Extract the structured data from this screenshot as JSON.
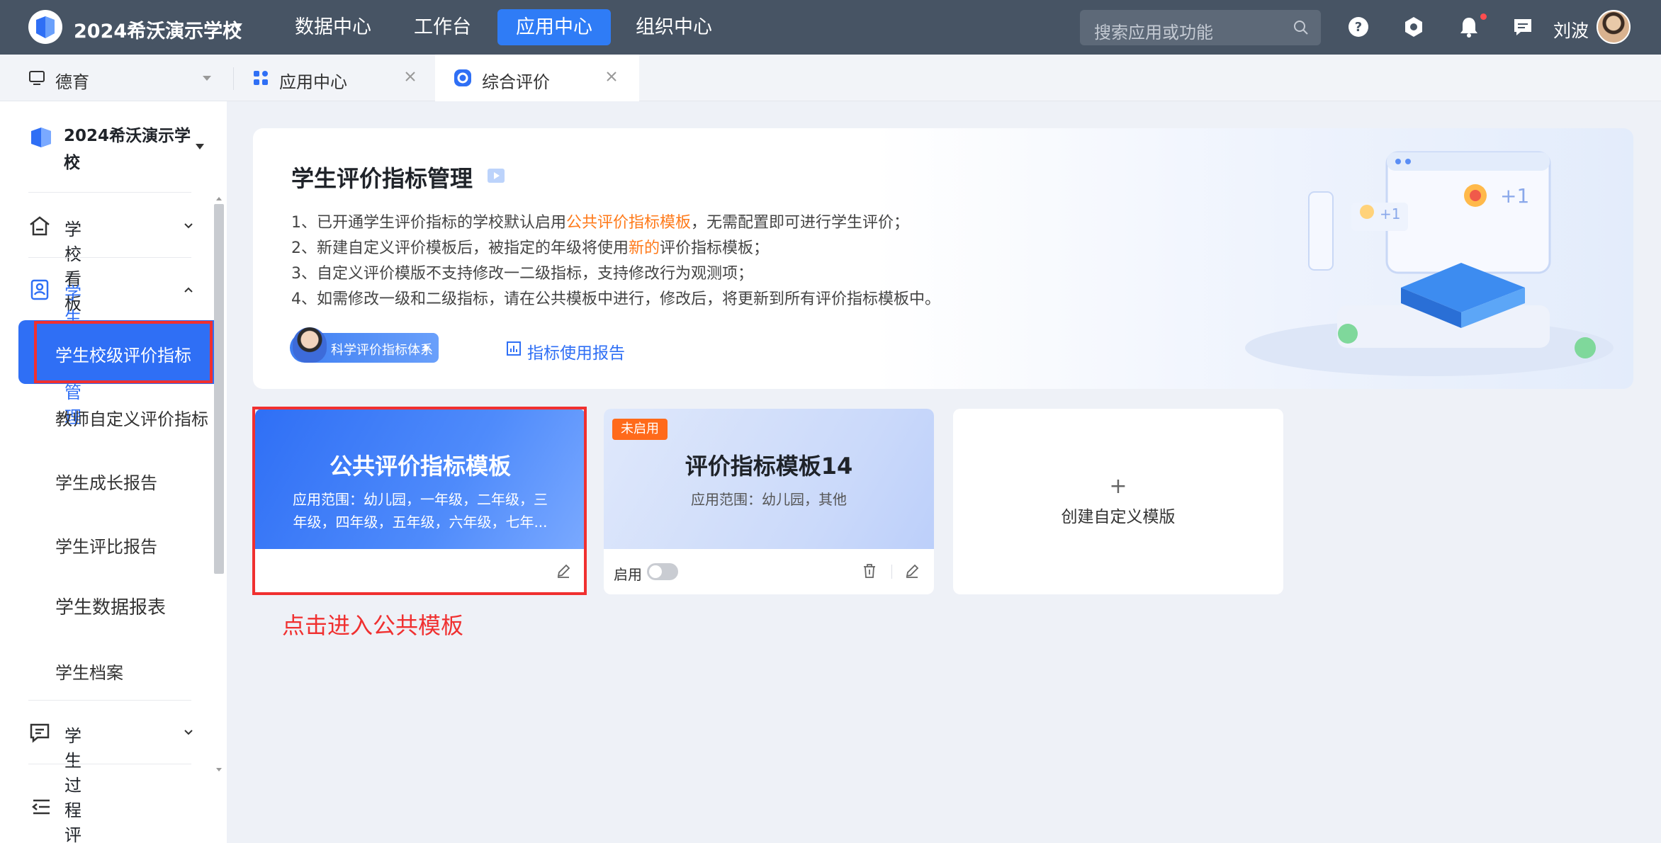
{
  "topbar": {
    "school_name": "2024希沃演示学校",
    "nav": [
      "数据中心",
      "工作台",
      "应用中心",
      "组织中心"
    ],
    "active_nav": "应用中心",
    "search_placeholder": "搜索应用或功能",
    "username": "刘波",
    "icons": [
      "help-icon",
      "settings-icon",
      "bell-icon",
      "message-icon"
    ]
  },
  "tabs": [
    {
      "label": "德育",
      "icon": "monitor-icon"
    },
    {
      "label": "应用中心",
      "icon": "grid-icon"
    },
    {
      "label": "综合评价",
      "icon": "app-icon",
      "active": true
    }
  ],
  "sidebar": {
    "school": "2024希沃演示学校",
    "groups": [
      {
        "label": "学校看板",
        "icon": "home-icon"
      },
      {
        "label": "学生成长管理",
        "icon": "student-icon",
        "open": true
      },
      {
        "label": "学生过程评价",
        "icon": "comment-icon"
      }
    ],
    "items": [
      "学生校级评价指标",
      "教师自定义评价指标",
      "学生成长报告",
      "学生评比报告",
      "学生数据报表",
      "学生档案"
    ],
    "active_item": "学生校级评价指标"
  },
  "banner": {
    "title": "学生评价指标管理",
    "line1_pre": "1、已开通学生评价指标的学校默认启用",
    "line1_hl": "公共评价指标模板",
    "line1_post": "，无需配置即可进行学生评价；",
    "line2_pre": "2、新建自定义评价模板后，被指定的年级将使用",
    "line2_hl": "新的",
    "line2_post": "评价指标模板；",
    "line3": "3、自定义评价模版不支持修改一二级指标，支持修改行为观测项；",
    "line4": "4、如需修改一级和二级指标，请在公共模板中进行，修改后，将更新到所有评价指标模板中。",
    "pill_label": "科学评价指标体系",
    "report_link": "指标使用报告",
    "highlight_color": "#ff7a1a"
  },
  "cards": {
    "public": {
      "title": "公共评价指标模板",
      "scope": "应用范围：幼儿园，一年级，二年级，三年级，四年级，五年级，六年级，七年..."
    },
    "custom": {
      "badge": "未启用",
      "title": "评价指标模板14",
      "scope": "应用范围：幼儿园，其他",
      "enable_label": "启用",
      "enabled": false
    },
    "create": {
      "plus": "+",
      "label": "创建自定义模版"
    }
  },
  "annotation": "点击进入公共模板",
  "colors": {
    "accent": "#2f6ff5",
    "topbar": "#475464",
    "annotation": "#f03030",
    "badge": "#ff6a1a"
  }
}
